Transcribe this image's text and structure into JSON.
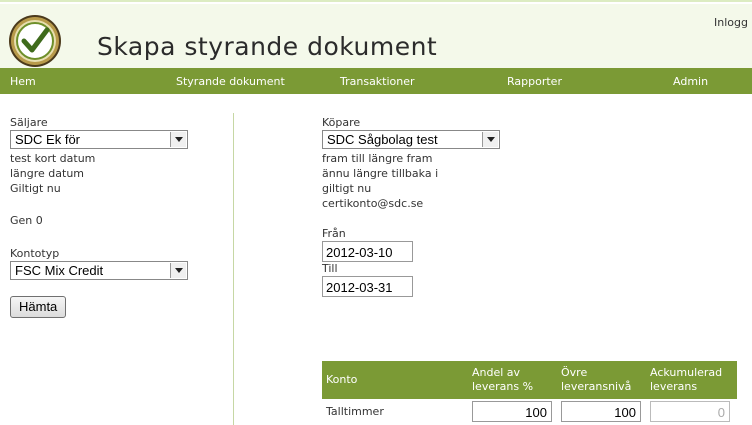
{
  "header": {
    "title": "Skapa styrande dokument",
    "login_label": "Inlogg"
  },
  "nav": {
    "items": [
      {
        "label": "Hem"
      },
      {
        "label": "Styrande dokument"
      },
      {
        "label": "Transaktioner"
      },
      {
        "label": "Rapporter"
      },
      {
        "label": "Admin"
      }
    ]
  },
  "seller": {
    "label": "Säljare",
    "selected": "SDC Ek för",
    "info": [
      "test kort datum",
      "längre datum",
      "Giltigt nu"
    ],
    "gen": "Gen 0",
    "account_type_label": "Kontotyp",
    "account_type_selected": "FSC Mix Credit",
    "fetch_button": "Hämta"
  },
  "buyer": {
    "label": "Köpare",
    "selected": "SDC Sågbolag test",
    "info": [
      "fram till längre fram",
      "ännu längre tillbaka i",
      "giltigt nu",
      "certikonto@sdc.se"
    ],
    "from_label": "Från",
    "from_value": "2012-03-10",
    "to_label": "Till",
    "to_value": "2012-03-31"
  },
  "table": {
    "headers": [
      "Konto",
      "Andel av leverans %",
      "Övre leveransnivå",
      "Ackumulerad leverans"
    ],
    "rows": [
      {
        "konto": "Talltimmer",
        "andel": "100",
        "ovre": "100",
        "ackumulerad": "0"
      }
    ]
  },
  "colors": {
    "nav_bg": "#7b9a35",
    "header_bg": "#f4f9ea",
    "divider": "#c6d7a4"
  },
  "icons": {
    "logo": "checkmark-badge-logo"
  }
}
